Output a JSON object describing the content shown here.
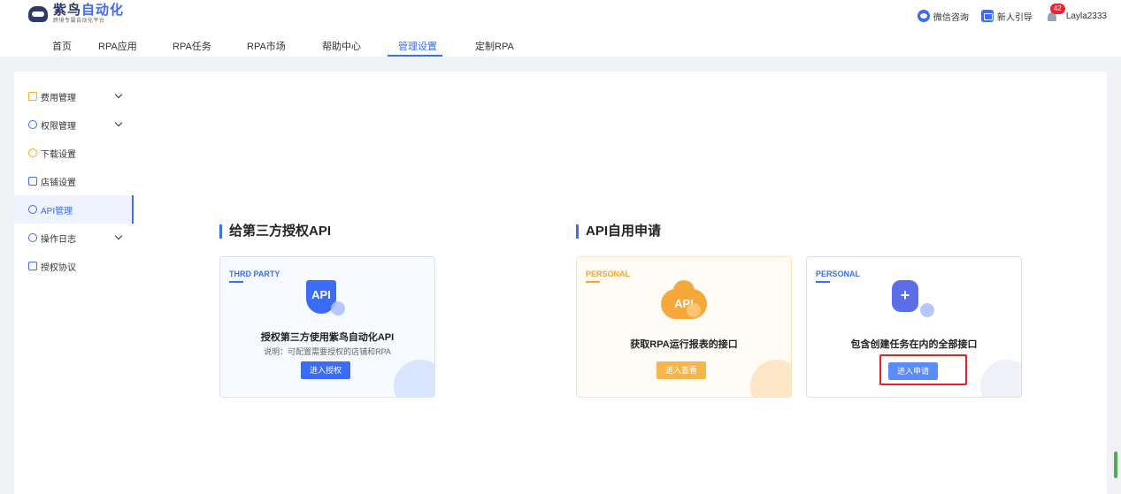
{
  "header": {
    "logo_main": "紫鸟",
    "logo_highlight": "自动化",
    "logo_sub": "跨境专属自动化平台",
    "nav": [
      "首页",
      "RPA应用",
      "RPA任务",
      "RPA市场",
      "帮助中心",
      "管理设置",
      "定制RPA"
    ],
    "active_nav": "管理设置",
    "wechat": "微信咨询",
    "guide": "新人引导",
    "notification_count": "42",
    "username": "Layla2333"
  },
  "sidebar": {
    "items": [
      {
        "label": "费用管理",
        "expandable": true
      },
      {
        "label": "权限管理",
        "expandable": true
      },
      {
        "label": "下载设置",
        "expandable": false
      },
      {
        "label": "店铺设置",
        "expandable": false
      },
      {
        "label": "API管理",
        "expandable": false,
        "active": true
      },
      {
        "label": "操作日志",
        "expandable": true
      },
      {
        "label": "授权协议",
        "expandable": false
      }
    ]
  },
  "sections": {
    "third_party": {
      "title": "给第三方授权API",
      "card": {
        "tag": "THRD PARTY",
        "icon_text": "API",
        "title": "授权第三方使用紫鸟自动化API",
        "desc": "说明：可配置需要授权的店铺和RPA",
        "button": "进入授权"
      }
    },
    "self_use": {
      "title": "API自用申请",
      "cards": [
        {
          "tag": "PERSONAL",
          "icon_text": "API",
          "title": "获取RPA运行报表的接口",
          "button": "进入查看"
        },
        {
          "tag": "PERSONAL",
          "icon_text": "+",
          "title": "包含创建任务在内的全部接口",
          "button": "进入申请"
        }
      ]
    }
  },
  "colors": {
    "accent": "#3b6cf6",
    "orange": "#f5a623",
    "highlight": "#e02424"
  }
}
